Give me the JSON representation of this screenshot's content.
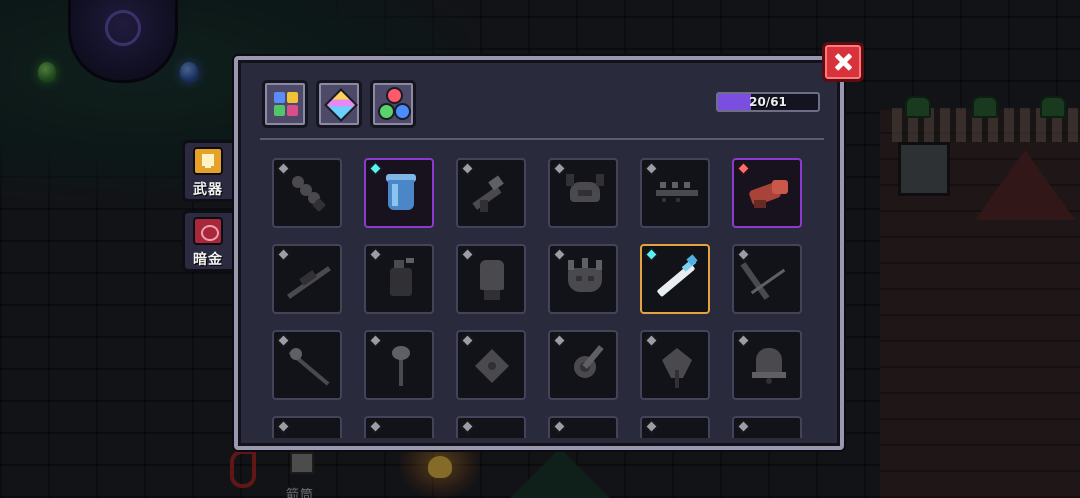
{
  "side_tabs": [
    {
      "label": "武器",
      "active": true,
      "color": "#e5a22a"
    },
    {
      "label": "暗金",
      "active": false,
      "color": "#a8283a"
    }
  ],
  "filters": [
    {
      "icon": "four-color-grid-icon"
    },
    {
      "icon": "rainbow-gem-icon"
    },
    {
      "icon": "tri-orb-icon"
    }
  ],
  "collection": {
    "text": "20/61",
    "collected": 20,
    "total": 61
  },
  "close_icon": "close-icon",
  "npc": {
    "name": "箭筒"
  },
  "grid_rows": [
    [
      {
        "icon": "spiked-club-icon",
        "rarity": "grey",
        "unlocked": false
      },
      {
        "icon": "blue-bucket-icon",
        "rarity": "cyan",
        "unlocked": true,
        "frame": "purple"
      },
      {
        "icon": "stone-gun-icon",
        "rarity": "grey",
        "unlocked": false
      },
      {
        "icon": "horned-helmet-icon",
        "rarity": "grey",
        "unlocked": false
      },
      {
        "icon": "chain-bar-icon",
        "rarity": "grey",
        "unlocked": false
      },
      {
        "icon": "red-cannon-icon",
        "rarity": "red",
        "unlocked": true,
        "frame": "purple"
      }
    ],
    [
      {
        "icon": "rifle-icon",
        "rarity": "grey",
        "unlocked": false
      },
      {
        "icon": "spray-can-icon",
        "rarity": "grey",
        "unlocked": false
      },
      {
        "icon": "stone-fist-icon",
        "rarity": "grey",
        "unlocked": false
      },
      {
        "icon": "crown-mask-icon",
        "rarity": "grey",
        "unlocked": false
      },
      {
        "icon": "ice-sword-icon",
        "rarity": "cyan",
        "unlocked": true,
        "selected": true
      },
      {
        "icon": "bow-icon",
        "rarity": "grey",
        "unlocked": false
      }
    ],
    [
      {
        "icon": "staff-icon",
        "rarity": "grey",
        "unlocked": false
      },
      {
        "icon": "wand-icon",
        "rarity": "grey",
        "unlocked": false
      },
      {
        "icon": "shuriken-icon",
        "rarity": "grey",
        "unlocked": false
      },
      {
        "icon": "gear-axe-icon",
        "rarity": "grey",
        "unlocked": false
      },
      {
        "icon": "claw-staff-icon",
        "rarity": "grey",
        "unlocked": false
      },
      {
        "icon": "bell-icon",
        "rarity": "grey",
        "unlocked": false
      }
    ],
    [
      {
        "icon": "unknown-item-icon",
        "rarity": "grey",
        "unlocked": false
      },
      {
        "icon": "unknown-item-icon",
        "rarity": "grey",
        "unlocked": false
      },
      {
        "icon": "unknown-item-icon",
        "rarity": "grey",
        "unlocked": false
      },
      {
        "icon": "unknown-item-icon",
        "rarity": "grey",
        "unlocked": false
      },
      {
        "icon": "unknown-item-icon",
        "rarity": "grey",
        "unlocked": false
      },
      {
        "icon": "unknown-item-icon",
        "rarity": "grey",
        "unlocked": false
      }
    ]
  ]
}
